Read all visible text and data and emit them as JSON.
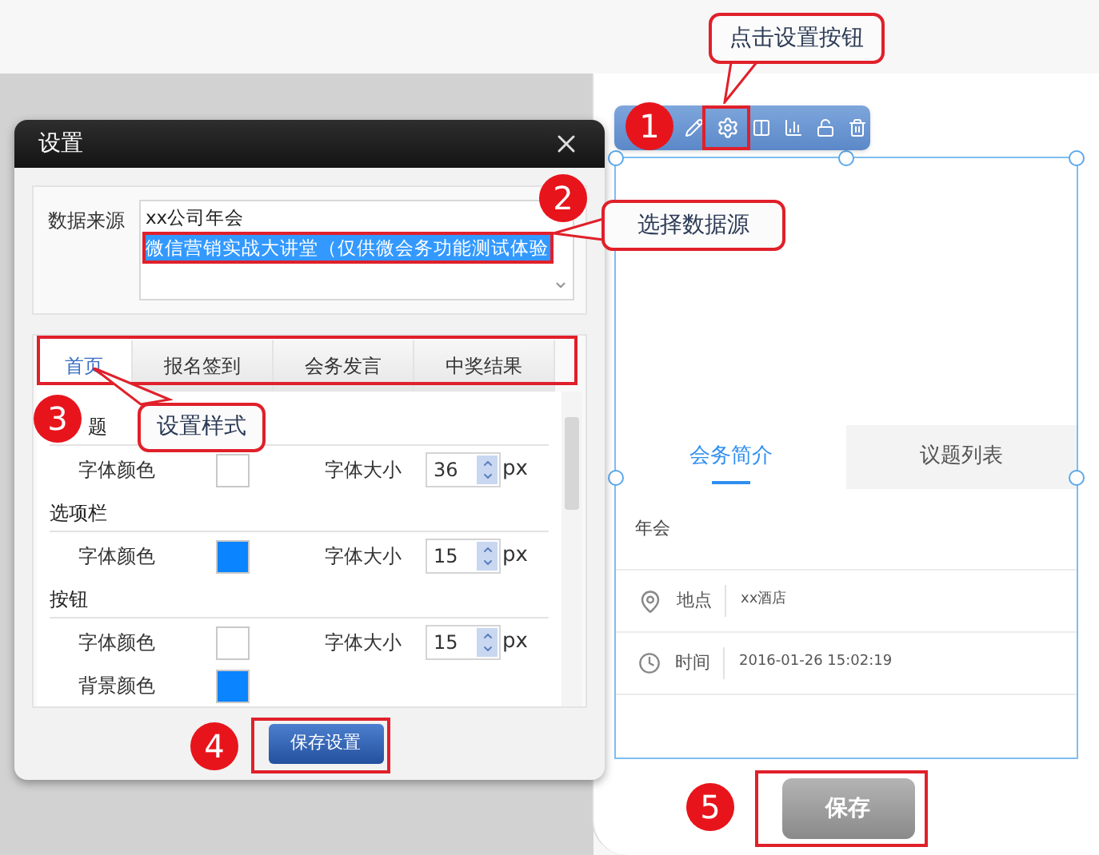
{
  "dialog": {
    "title": "设置",
    "data_source": {
      "label": "数据来源",
      "options": [
        {
          "text": "xx公司年会",
          "selected": false
        },
        {
          "text": "微信营销实战大讲堂（仅供微会务功能测试体验",
          "selected": true
        }
      ]
    },
    "tabs": [
      {
        "label": "首页",
        "selected": true
      },
      {
        "label": "报名签到",
        "selected": false
      },
      {
        "label": "会务发言",
        "selected": false
      },
      {
        "label": "中奖结果",
        "selected": false
      }
    ],
    "sections": [
      {
        "heading": "题",
        "rows": [
          {
            "kind": "color-size",
            "label": "字体颜色",
            "color": "#ffffff",
            "size_label": "字体大小",
            "value": "36",
            "unit": "px"
          }
        ]
      },
      {
        "heading": "选项栏",
        "rows": [
          {
            "kind": "color-size",
            "label": "字体颜色",
            "color": "#0a84ff",
            "size_label": "字体大小",
            "value": "15",
            "unit": "px"
          }
        ]
      },
      {
        "heading": "按钮",
        "rows": [
          {
            "kind": "color-size",
            "label": "字体颜色",
            "color": "#ffffff",
            "size_label": "字体大小",
            "value": "15",
            "unit": "px"
          },
          {
            "kind": "color",
            "label": "背景颜色",
            "color": "#0a84ff"
          }
        ]
      }
    ],
    "save_button": "保存设置"
  },
  "phone": {
    "tabs": [
      {
        "label": "会务简介",
        "selected": true
      },
      {
        "label": "议题列表",
        "selected": false
      }
    ],
    "intro": "年会",
    "info": [
      {
        "kind": "location",
        "label": "地点",
        "value": "xx酒店"
      },
      {
        "kind": "time",
        "label": "时间",
        "value": "2016-01-26 15:02:19"
      }
    ],
    "save_button": "保存"
  },
  "annotations": [
    {
      "number": "1",
      "callout": "点击设置按钮"
    },
    {
      "number": "2",
      "callout": "选择数据源"
    },
    {
      "number": "3",
      "callout": "设置样式"
    },
    {
      "number": "4"
    },
    {
      "number": "5"
    }
  ]
}
